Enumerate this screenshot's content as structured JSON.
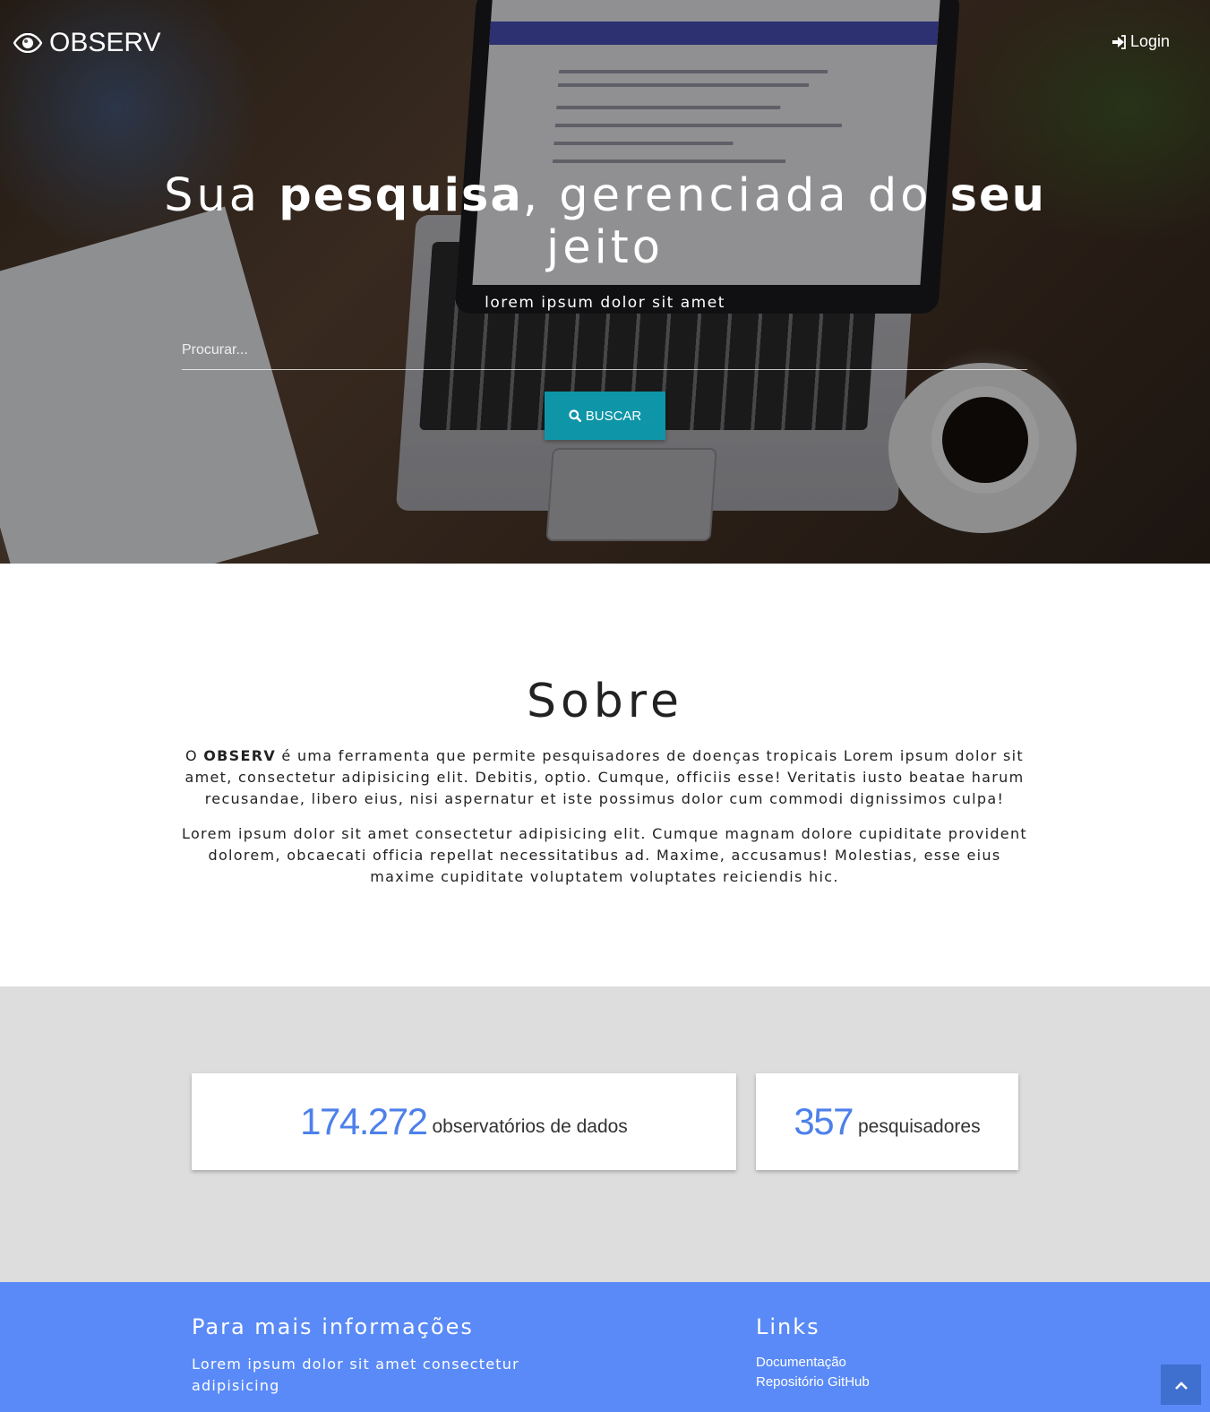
{
  "nav": {
    "brand": "OBSERV",
    "brand_icon": "eye-icon",
    "login_label": "Login",
    "login_icon": "sign-in-icon"
  },
  "hero": {
    "title_1": "Sua ",
    "title_bold_1": "pesquisa",
    "title_2": ", gerenciada do ",
    "title_bold_2": "seu",
    "title_3": " jeito",
    "subtitle": "lorem ipsum dolor sit amet",
    "search_placeholder": "Procurar...",
    "search_value": "",
    "search_button": "BUSCAR",
    "search_icon": "search-icon",
    "button_color": "#0f95a8"
  },
  "sobre": {
    "title": "Sobre",
    "p1_before": "O ",
    "p1_bold": "OBSERV",
    "p1_after": " é uma ferramenta que permite pesquisadores de doenças tropicais Lorem ipsum dolor sit amet, consectetur adipisicing elit. Debitis, optio. Cumque, officiis esse! Veritatis iusto beatae harum recusandae, libero eius, nisi aspernatur et iste possimus dolor cum commodi dignissimos culpa!",
    "p2": "Lorem ipsum dolor sit amet consectetur adipisicing elit. Cumque magnam dolore cupiditate provident dolorem, obcaecati officia repellat necessitatibus ad. Maxime, accusamus! Molestias, esse eius maxime cupiditate voluptatem voluptates reiciendis hic."
  },
  "stats": [
    {
      "value": "174.272",
      "label": "observatórios de dados"
    },
    {
      "value": "357",
      "label": "pesquisadores"
    }
  ],
  "footer": {
    "info_title": "Para mais informações",
    "info_text": "Lorem ipsum dolor sit amet consectetur adipisicing",
    "links_title": "Links",
    "links": [
      "Documentação",
      "Repositório GitHub"
    ],
    "background": "#5a8af7"
  },
  "scroll_top_icon": "chevron-up-icon",
  "accent_color": "#4d80ea"
}
